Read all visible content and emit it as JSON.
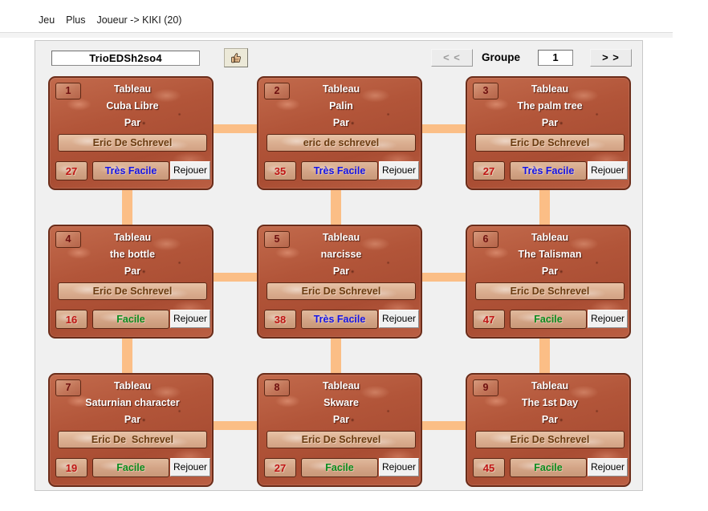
{
  "menubar": {
    "items": [
      {
        "label": "Jeu"
      },
      {
        "label": "Plus"
      },
      {
        "label": "Joueur -> KIKI (20)"
      }
    ]
  },
  "toolbar": {
    "level_name": "TrioEDSh2so4",
    "thumbs_up_icon": "thumbs-up-icon",
    "prev_group_label": "< <",
    "group_label": "Groupe",
    "group_number": "1",
    "next_group_label": "> >"
  },
  "colors": {
    "difficulty_tres_facile": "#1414e6",
    "difficulty_facile": "#0a8c1e",
    "score": "#c01515",
    "connector": "#fbbe86",
    "card_stone": "#b5563c",
    "author_text": "#6a3b10"
  },
  "labels": {
    "tableau": "Tableau",
    "par": "Par",
    "replay": "Rejouer"
  },
  "cards": [
    {
      "number": "1",
      "tableau": "Tableau",
      "title": "Cuba Libre",
      "par": "Par",
      "author": "Eric De Schrevel",
      "score": "27",
      "difficulty": "Très Facile",
      "difficulty_color": "#1414e6",
      "replay": "Rejouer"
    },
    {
      "number": "2",
      "tableau": "Tableau",
      "title": "Palin",
      "par": "Par",
      "author": "eric de schrevel",
      "score": "35",
      "difficulty": "Très Facile",
      "difficulty_color": "#1414e6",
      "replay": "Rejouer"
    },
    {
      "number": "3",
      "tableau": "Tableau",
      "title": "The palm tree",
      "par": "Par",
      "author": "Eric De Schrevel",
      "score": "27",
      "difficulty": "Très Facile",
      "difficulty_color": "#1414e6",
      "replay": "Rejouer"
    },
    {
      "number": "4",
      "tableau": "Tableau",
      "title": "the bottle",
      "par": "Par",
      "author": "Eric De Schrevel",
      "score": "16",
      "difficulty": "Facile",
      "difficulty_color": "#0a8c1e",
      "replay": "Rejouer"
    },
    {
      "number": "5",
      "tableau": "Tableau",
      "title": "narcisse",
      "par": "Par",
      "author": "Eric De Schrevel",
      "score": "38",
      "difficulty": "Très Facile",
      "difficulty_color": "#1414e6",
      "replay": "Rejouer"
    },
    {
      "number": "6",
      "tableau": "Tableau",
      "title": "The Talisman",
      "par": "Par",
      "author": "Eric De Schrevel",
      "score": "47",
      "difficulty": "Facile",
      "difficulty_color": "#0a8c1e",
      "replay": "Rejouer"
    },
    {
      "number": "7",
      "tableau": "Tableau",
      "title": "Saturnian character",
      "par": "Par",
      "author": "Eric De  Schrevel",
      "score": "19",
      "difficulty": "Facile",
      "difficulty_color": "#0a8c1e",
      "replay": "Rejouer"
    },
    {
      "number": "8",
      "tableau": "Tableau",
      "title": "Skware",
      "par": "Par",
      "author": "Eric De Schrevel",
      "score": "27",
      "difficulty": "Facile",
      "difficulty_color": "#0a8c1e",
      "replay": "Rejouer"
    },
    {
      "number": "9",
      "tableau": "Tableau",
      "title": "The 1st Day",
      "par": "Par",
      "author": "Eric De Schrevel",
      "score": "45",
      "difficulty": "Facile",
      "difficulty_color": "#0a8c1e",
      "replay": "Rejouer"
    }
  ]
}
